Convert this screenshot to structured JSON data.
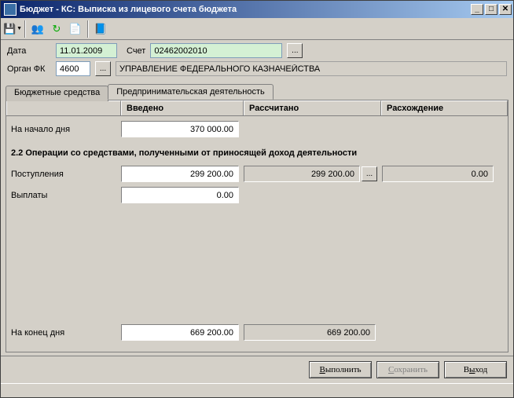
{
  "window": {
    "title": "Бюджет - КС: Выписка из лицевого счета бюджета"
  },
  "toolbar": {
    "save_icon": "💾",
    "people_icon": "👥",
    "refresh_icon": "↻",
    "doc_icon": "📄",
    "book_icon": "📘"
  },
  "form": {
    "date_label": "Дата",
    "date_value": "11.01.2009",
    "account_label": "Счет",
    "account_value": "02462002010",
    "organ_label": "Орган ФК",
    "organ_value": "4600",
    "organ_name": "УПРАВЛЕНИЕ ФЕДЕРАЛЬНОГО КАЗНАЧЕЙСТВА",
    "dots": "..."
  },
  "tabs": {
    "budget": "Бюджетные средства",
    "business": "Предпринимательская деятельность"
  },
  "grid": {
    "h1": "Введено",
    "h2": "Рассчитано",
    "h3": "Расхождение",
    "begin_label": "На начало дня",
    "begin_val": "370 000.00",
    "section": "2.2 Операции со средствами, полученными от приносящей доход деятельности",
    "incoming_label": "Поступления",
    "incoming_entered": "299 200.00",
    "incoming_calc": "299 200.00",
    "incoming_diff": "0.00",
    "payments_label": "Выплаты",
    "payments_entered": "0.00",
    "end_label": "На конец дня",
    "end_entered": "669 200.00",
    "end_calc": "669 200.00",
    "dots": "..."
  },
  "buttons": {
    "execute": "Выполнить",
    "execute_u": "В",
    "save": "Сохранить",
    "save_u": "С",
    "exit": "Выход",
    "exit_u": "ы"
  }
}
